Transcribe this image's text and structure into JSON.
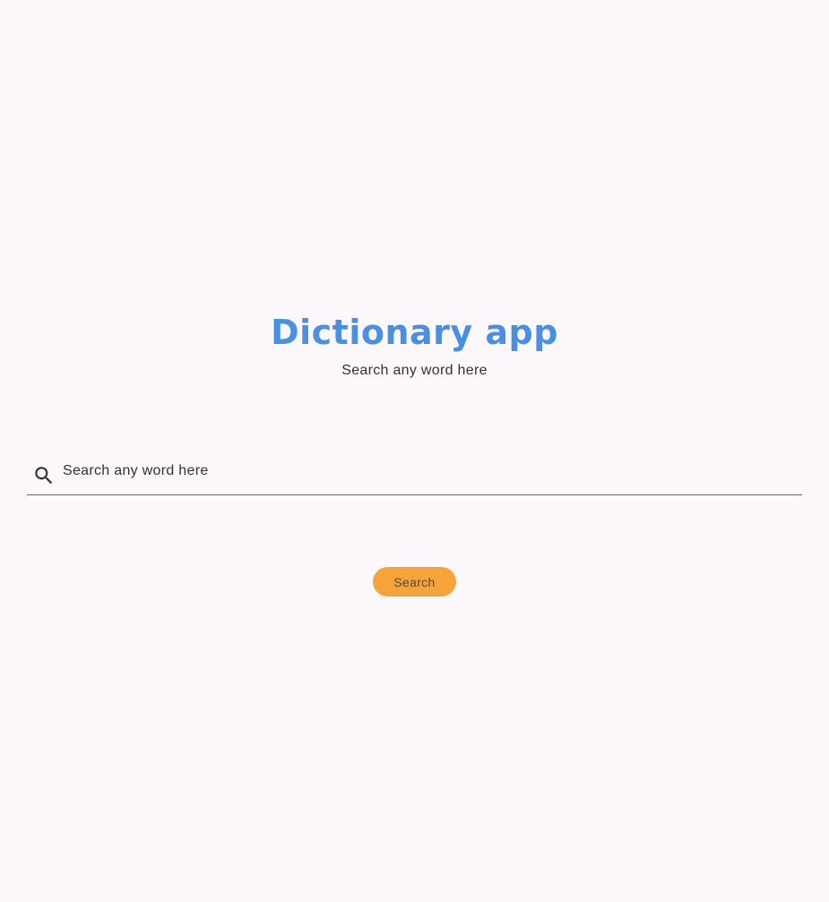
{
  "header": {
    "title": "Dictionary app",
    "subtitle": "Search any word here"
  },
  "search": {
    "icon": "search-icon",
    "placeholder": "Search any word here",
    "value": ""
  },
  "actions": {
    "search_label": "Search"
  },
  "colors": {
    "background": "#fcf8fc",
    "title": "#4a90e2",
    "button": "#f5a33a",
    "text": "#333333"
  }
}
